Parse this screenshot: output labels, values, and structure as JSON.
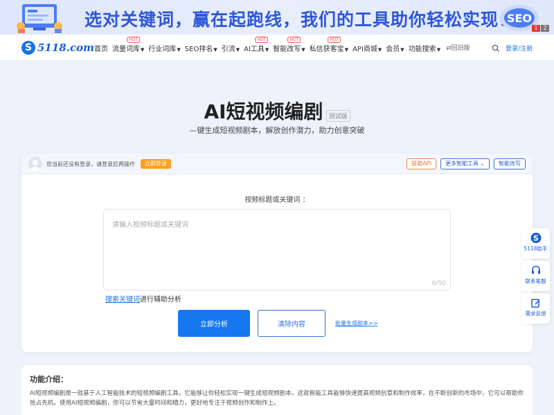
{
  "banner": {
    "slogan": "选对关键词，赢在起跑线，我们的工具助你轻松实现！",
    "art_right_text": "SEO",
    "pager": [
      "1",
      "2"
    ]
  },
  "nav": {
    "logo_text": "5118.com",
    "items": [
      {
        "label": "首页",
        "caret": false,
        "hot": false
      },
      {
        "label": "流量词库",
        "caret": true,
        "hot": true
      },
      {
        "label": "行业词库",
        "caret": true,
        "hot": false
      },
      {
        "label": "SEO排名",
        "caret": true,
        "hot": false
      },
      {
        "label": "引流",
        "caret": true,
        "hot": false
      },
      {
        "label": "AI工具",
        "caret": true,
        "hot": true
      },
      {
        "label": "智能改写",
        "caret": true,
        "hot": true
      },
      {
        "label": "私信获客宝",
        "caret": true,
        "hot": true
      },
      {
        "label": "API商城",
        "caret": true,
        "hot": false
      },
      {
        "label": "会员",
        "caret": true,
        "hot": false
      },
      {
        "label": "功能搜索",
        "caret": true,
        "hot": false
      }
    ],
    "hot_label": "HOT",
    "old_version": "⇄回旧版",
    "login_register": "登录/注册"
  },
  "hero": {
    "title": "AI短视频编剧",
    "badge": "测试版",
    "subtitle": "—键生成短视频剧本，解放创作潜力，助力创意突破"
  },
  "card": {
    "login_tip": "您当前还没有登录，请登录后再操作",
    "login_button": "立即登录",
    "api_button": "获取API",
    "more_tools_button": "更多智能工具",
    "rewrite_button": "智能改写",
    "field_label": "视频标题或关键词 ：",
    "placeholder": "请输入视频标题或关键词",
    "counter": "0/50",
    "assist_link": "搜索关键词",
    "assist_text": "进行辅助分析",
    "analyze_button": "立即分析",
    "clear_button": "清除内容",
    "batch_link": "批量生成剧本>>"
  },
  "intro": {
    "heading": "功能介绍：",
    "text": "AI短视频编剧是一款基于人工智能技术的短视频编剧工具，它能够让你轻松实现一键生成短视频剧本。这款智能工具能够快速提高视频创意和制作效率，在不断创新的市场中，它可以帮助你抢占先机。使用AI短视频编剧，你可以节省大量时间和精力，更好地专注于视频创作和制作上。"
  },
  "float": [
    {
      "label": "5118助手",
      "icon": "logo-icon"
    },
    {
      "label": "联系客服",
      "icon": "headset-icon"
    },
    {
      "label": "需求反馈",
      "icon": "edit-icon"
    }
  ],
  "colors": {
    "primary": "#1677ee",
    "accent_orange": "#ff9f1c",
    "hot_red": "#ff4d4f",
    "banner_blue": "#2f56d8"
  }
}
